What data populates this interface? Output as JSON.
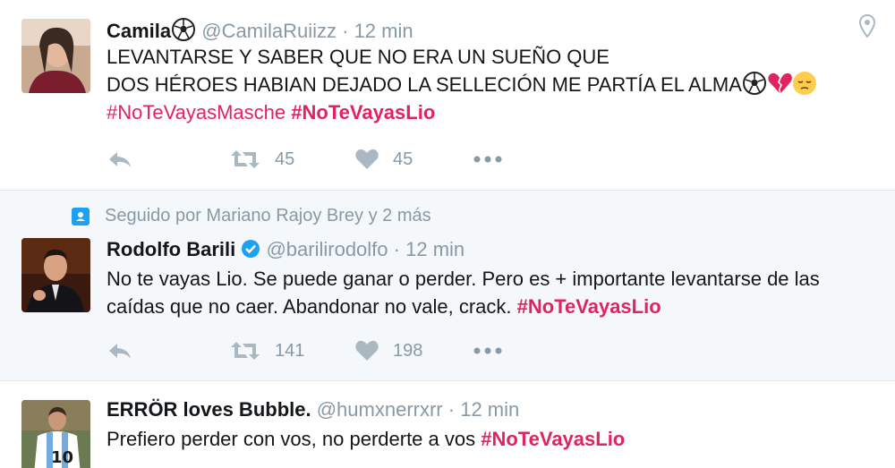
{
  "tweets": [
    {
      "name": "Camila",
      "handle": "@CamilaRuiizz",
      "separator": "·",
      "time": "12 min",
      "lines": [
        "LEVANTARSE Y SABER QUE NO ERA UN SUEÑO QUE",
        "DOS HÉROES HABIAN DEJADO LA SELLECIÓN ME PARTÍA EL ALMA"
      ],
      "hashtags": [
        "#NoTeVayasMasche",
        "#NoTeVayasLio"
      ],
      "retweets": "45",
      "likes": "45",
      "icons": [
        "soccer-ball-icon",
        "broken-heart-icon",
        "pensive-face-icon",
        "location-pin-icon"
      ]
    },
    {
      "context": "Seguido por Mariano Rajoy Brey y 2 más",
      "name": "Rodolfo Barili",
      "verified": true,
      "handle": "@barilirodolfo",
      "separator": "·",
      "time": "12 min",
      "lines": [
        "No te vayas Lio. Se puede ganar o perder. Pero es + importante levantarse de las",
        "caídas que no caer. Abandonar no vale, crack."
      ],
      "hashtag": "#NoTeVayasLio",
      "retweets": "141",
      "likes": "198"
    },
    {
      "name": "ERRÖR loves Bubble.",
      "handle": "@humxnerrxrr",
      "separator": "·",
      "time": "12 min",
      "text": "Prefiero perder con vos, no perderte a vos",
      "hashtag": "#NoTeVayasLio"
    }
  ],
  "colors": {
    "hashtag": "#e0245e",
    "muted": "#8899a6",
    "verified": "#1da1f2",
    "highlight_bg": "#f5f8fa"
  }
}
